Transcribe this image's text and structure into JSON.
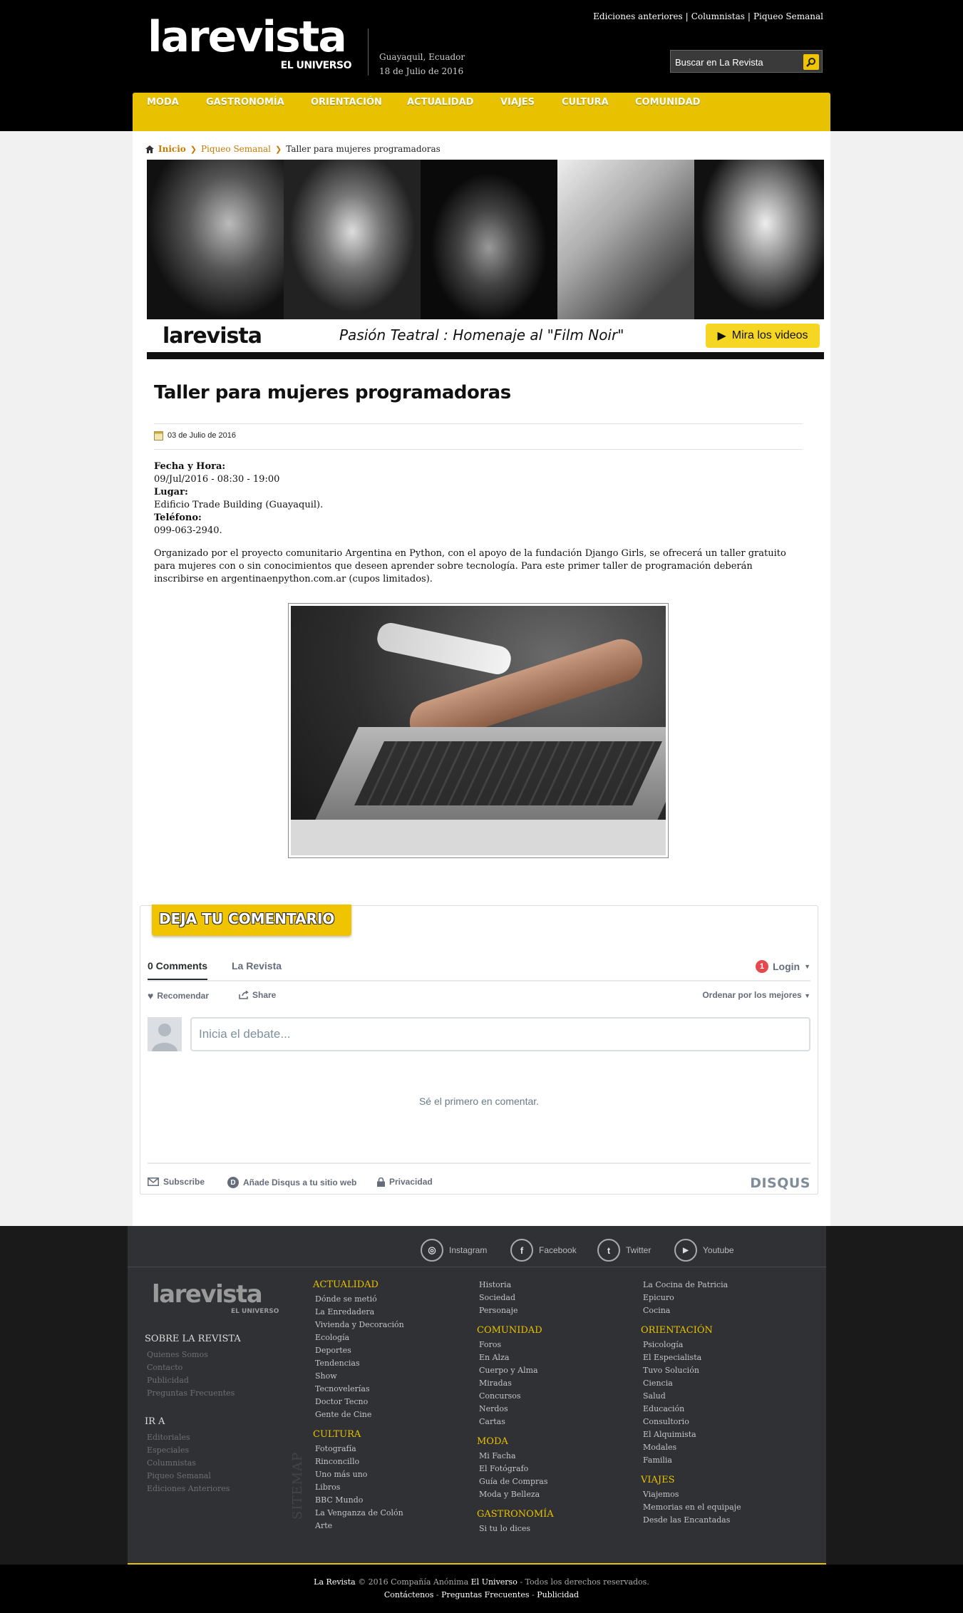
{
  "header": {
    "logo_main": "larevista",
    "logo_sub": "EL UNIVERSO",
    "location": "Guayaquil, Ecuador",
    "date": "18 de Julio de 2016",
    "toplinks": [
      "Ediciones anteriores",
      "Columnistas",
      "Piqueo Semanal"
    ],
    "search_placeholder": "Buscar en La Revista"
  },
  "nav": [
    "MODA",
    "GASTRONOMÍA",
    "ORIENTACIÓN",
    "ACTUALIDAD",
    "VIAJES",
    "CULTURA",
    "COMUNIDAD"
  ],
  "breadcrumb": {
    "home": "Inicio",
    "section": "Piqueo Semanal",
    "current": "Taller para mujeres programadoras"
  },
  "banner": {
    "logo": "larevista",
    "title": "Pasión Teatral : Homenaje al \"Film Noir\"",
    "button": "Mira los videos"
  },
  "article": {
    "title": "Taller para mujeres programadoras",
    "date": "03 de Julio de 2016",
    "label_fecha": "Fecha y Hora:",
    "fecha": "09/Jul/2016 - 08:30 - 19:00",
    "label_lugar": "Lugar:",
    "lugar": "Edificio Trade Building (Guayaquil).",
    "label_telefono": "Teléfono:",
    "telefono": "099-063-2940.",
    "body": "Organizado por el proyecto comunitario Argentina en Python, con el apoyo de la fundación Django Girls, se ofrecerá un taller gratuito para mujeres con o sin conocimientos que deseen aprender sobre tecnología. Para este primer taller de programación deberán inscribirse en argentinaenpython.com.ar (cupos limitados)."
  },
  "comments": {
    "ribbon": "DEJA TU COMENTARIO",
    "tab_count": "0 Comments",
    "tab_site": "La Revista",
    "login": "Login",
    "login_badge": "1",
    "recommend": "Recomendar",
    "share": "Share",
    "order": "Ordenar por los mejores",
    "input_placeholder": "Inicia el debate...",
    "empty": "Sé el primero en comentar.",
    "subscribe": "Subscribe",
    "add_disqus": "Añade Disqus a tu sitio web",
    "privacy": "Privacidad",
    "brand": "DISQUS"
  },
  "footer": {
    "social": [
      "Instagram",
      "Facebook",
      "Twitter",
      "Youtube"
    ],
    "logo_main": "larevista",
    "logo_sub": "EL UNIVERSO",
    "sobre_title": "SOBRE LA REVISTA",
    "sobre_links": [
      "Quienes Somos",
      "Contacto",
      "Publicidad",
      "Preguntas Frecuentes"
    ],
    "ira_title": "IR A",
    "ira_links": [
      "Editoriales",
      "Especiales",
      "Columnistas",
      "Piqueo Semanal",
      "Ediciones Anteriores"
    ],
    "sitemap": "SITEMAP",
    "actualidad_title": "ACTUALIDAD",
    "actualidad_links": [
      "Dónde se metió",
      "La Enredadera",
      "Vivienda y Decoración",
      "Ecología",
      "Deportes",
      "Tendencias",
      "Show",
      "Tecnovelerías",
      "Doctor Tecno",
      "Gente de Cine"
    ],
    "cultura_title": "CULTURA",
    "cultura_links": [
      "Fotografía",
      "Rinconcillo",
      "Uno más uno",
      "Libros",
      "BBC Mundo",
      "La Venganza de Colón",
      "Arte"
    ],
    "col3_top_links": [
      "Historia",
      "Sociedad",
      "Personaje"
    ],
    "comunidad_title": "COMUNIDAD",
    "comunidad_links": [
      "Foros",
      "En Alza",
      "Cuerpo y Alma",
      "Miradas",
      "Concursos",
      "Nerdos",
      "Cartas"
    ],
    "moda_title": "MODA",
    "moda_links": [
      "Mi Facha",
      "El Fotógrafo",
      "Guía de Compras",
      "Moda y Belleza"
    ],
    "gastronomia_title": "GASTRONOMÍA",
    "gastronomia_links": [
      "Si tu lo dices"
    ],
    "col4_top_links": [
      "La Cocina de Patricia",
      "Epicuro",
      "Cocina"
    ],
    "orientacion_title": "ORIENTACIÓN",
    "orientacion_links": [
      "Psicología",
      "El Especialista",
      "Tuvo Solución",
      "Ciencia",
      "Salud",
      "Educación",
      "Consultorio",
      "El Alquimista",
      "Modales",
      "Familia"
    ],
    "viajes_title": "VIAJES",
    "viajes_links": [
      "Viajemos",
      "Memorias en el equipaje",
      "Desde las Encantadas"
    ]
  },
  "bottom": {
    "brand": "La Revista",
    "copy": "© 2016 Compañía Anónima",
    "company": "El Universo",
    "rights": "- Todos los derechos reservados.",
    "links": [
      "Contáctenos",
      "Preguntas Frecuentes",
      "Publicidad"
    ]
  }
}
